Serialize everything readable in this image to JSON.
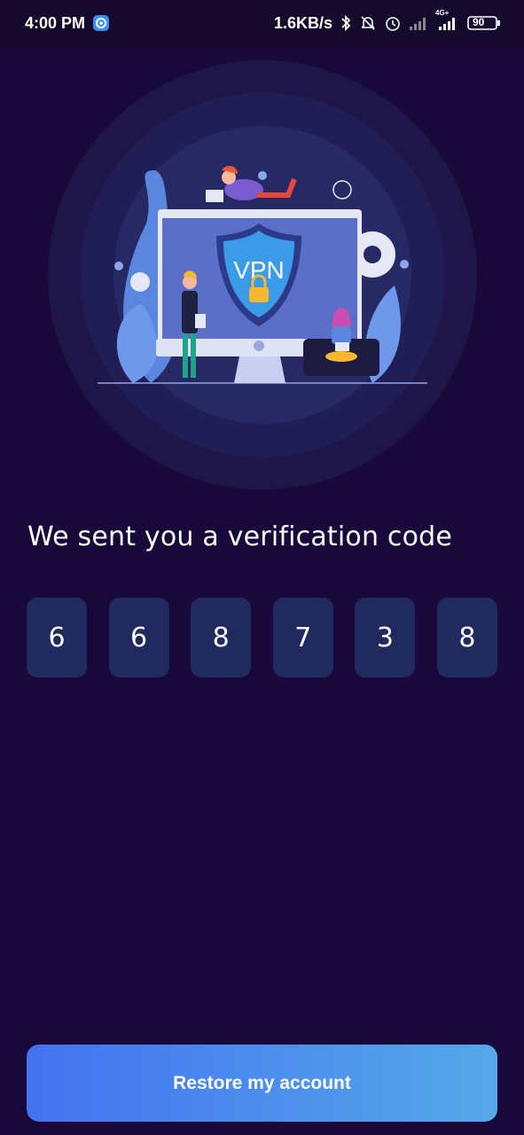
{
  "status_bar": {
    "time": "4:00 PM",
    "net_speed": "1.6KB/s",
    "network_type": "4G+",
    "battery": "90",
    "icons": [
      "app-notification-icon",
      "bluetooth-icon",
      "mute-icon",
      "alarm-icon",
      "signal-icon",
      "signal-4g-icon",
      "battery-icon"
    ]
  },
  "hero": {
    "shield_text": "VPN"
  },
  "main": {
    "title": "We sent you a verification code",
    "code_digits": [
      "6",
      "6",
      "8",
      "7",
      "3",
      "8"
    ]
  },
  "actions": {
    "restore_label": "Restore my account"
  },
  "colors": {
    "background": "#19093a",
    "code_box": "#212a5e",
    "button_gradient_start": "#4472f0",
    "button_gradient_end": "#55a8ea"
  }
}
